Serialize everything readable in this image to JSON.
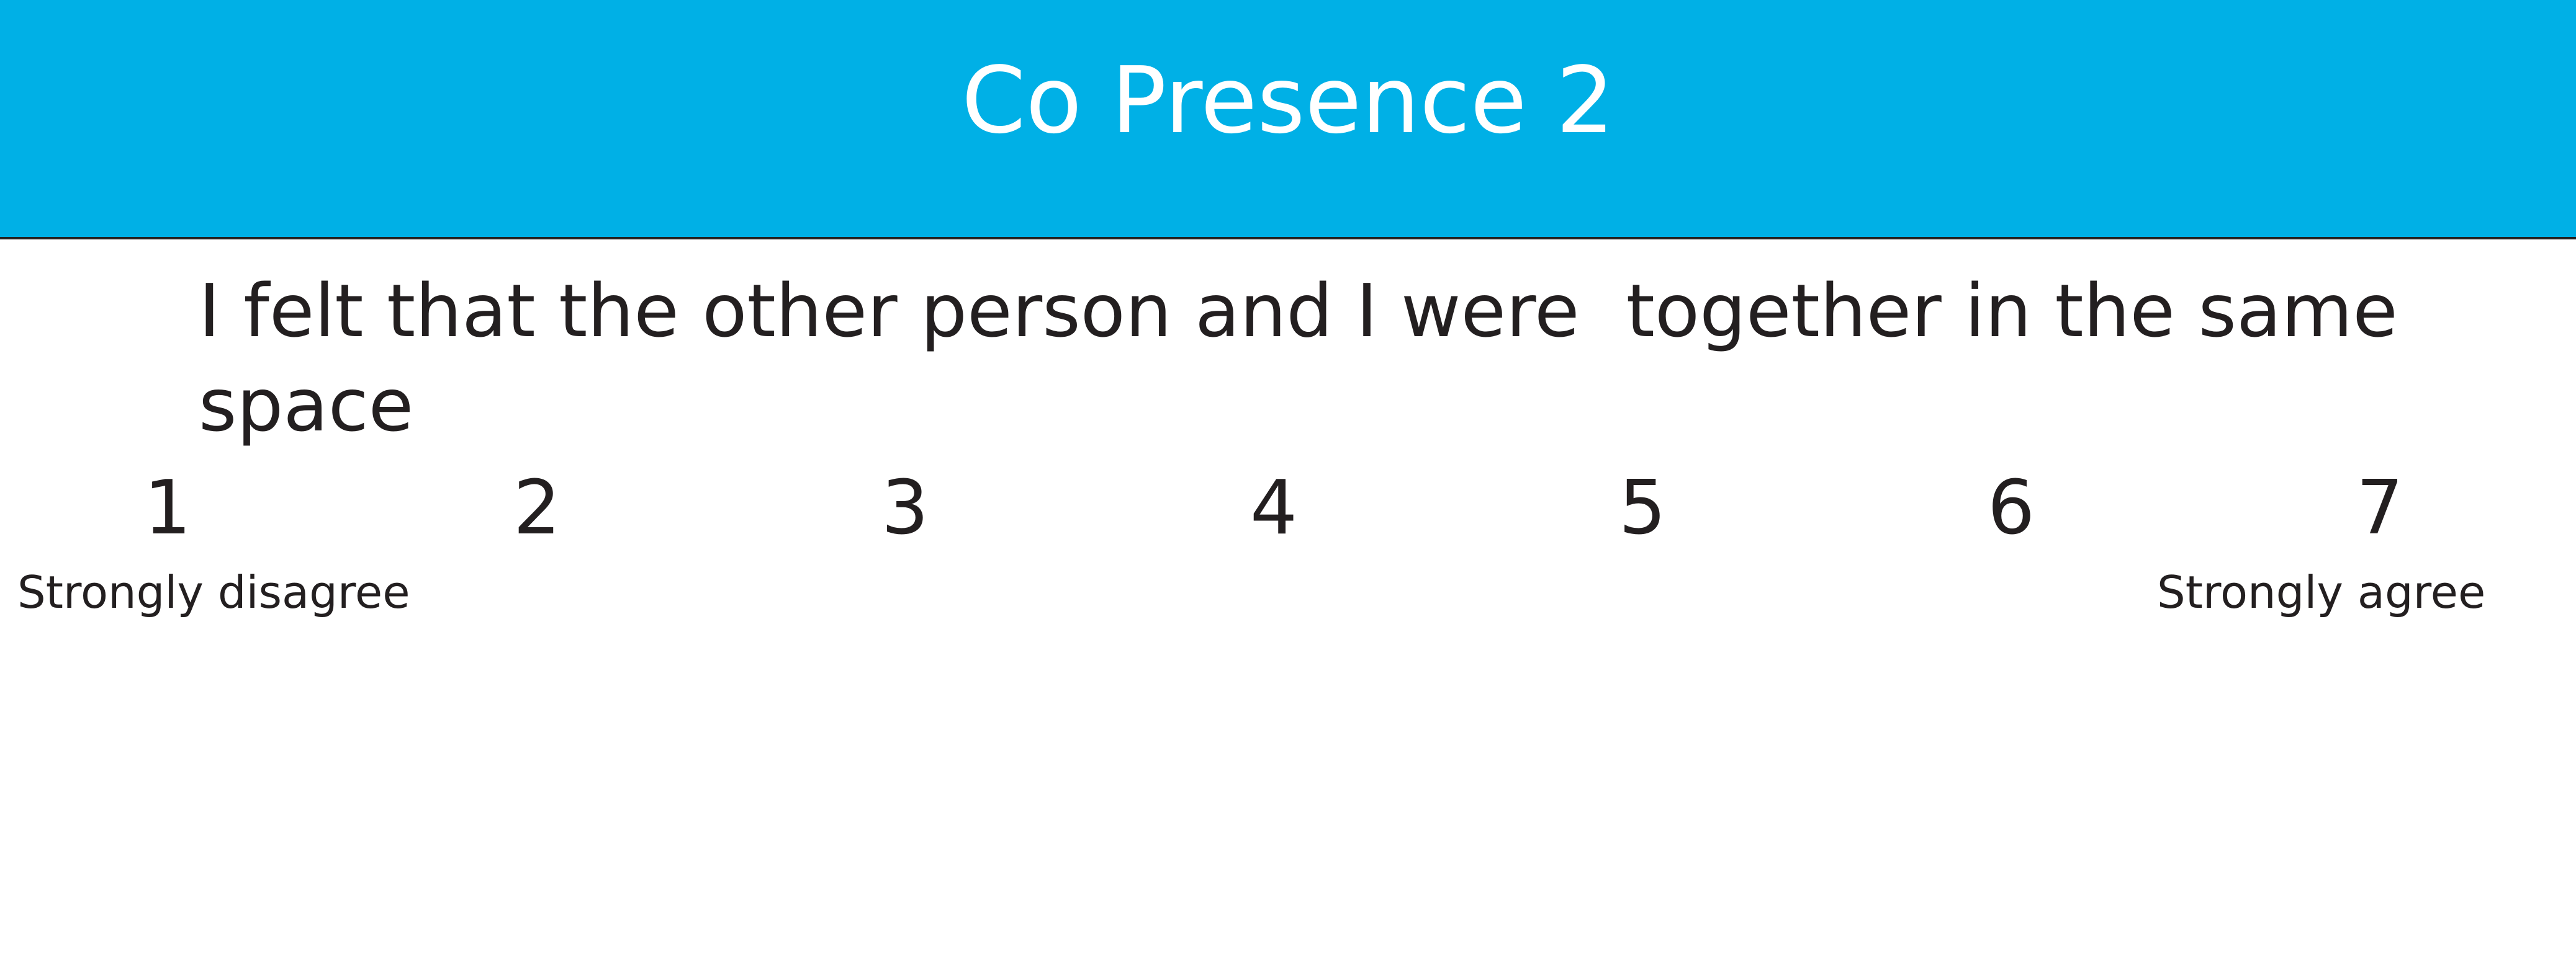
{
  "header": {
    "title": "Co Presence 2",
    "background_color": "#00b0e6"
  },
  "question": {
    "text": "I felt that the other person and I were  together in the same space"
  },
  "scale": {
    "points": [
      "1",
      "2",
      "3",
      "4",
      "5",
      "6",
      "7"
    ],
    "min_label": "Strongly disagree",
    "max_label": "Strongly agree"
  }
}
